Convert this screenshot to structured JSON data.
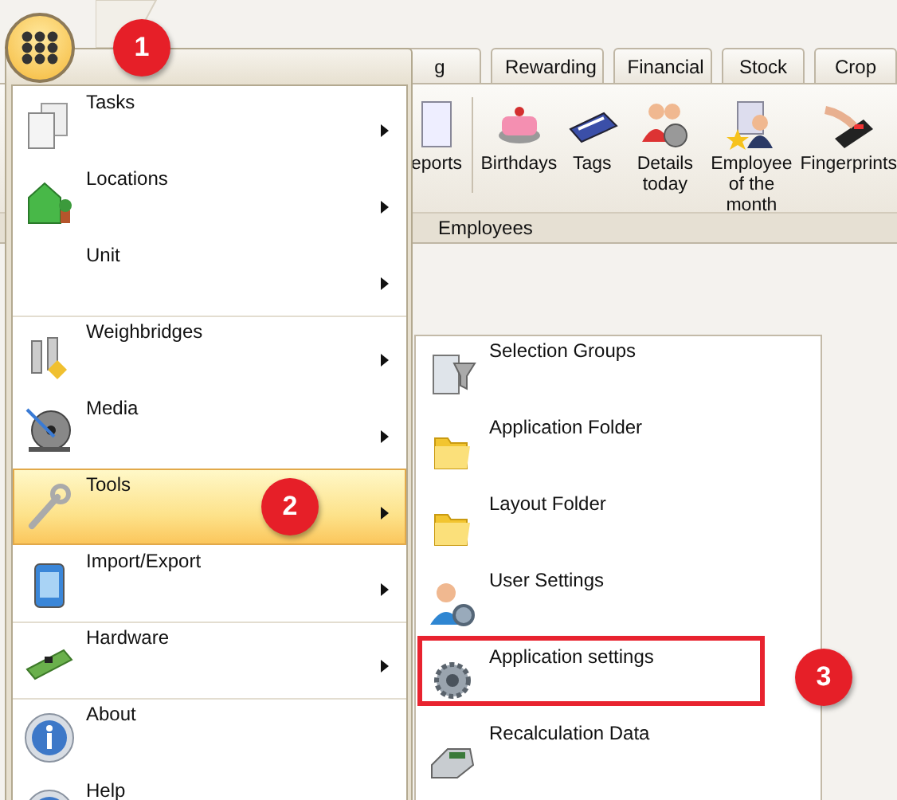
{
  "app_button": {
    "selected": true
  },
  "tabs": [
    {
      "label": "g",
      "selected": false
    },
    {
      "label": "Rewarding",
      "selected": false
    },
    {
      "label": "Financial",
      "selected": false
    },
    {
      "label": "Stock",
      "selected": false
    },
    {
      "label": "Crop",
      "selected": false
    }
  ],
  "ribbon": {
    "buttons": [
      {
        "label": "eports"
      },
      {
        "label": "Birthdays"
      },
      {
        "label": "Tags"
      },
      {
        "label": "Details today"
      },
      {
        "label": "Employee of the month"
      },
      {
        "label": "Fingerprints"
      }
    ],
    "group_label": "Employees"
  },
  "menu": {
    "items": [
      {
        "label": "Tasks",
        "submenu": true,
        "selected": false,
        "separator_before": false
      },
      {
        "label": "Locations",
        "submenu": true,
        "selected": false,
        "separator_before": false
      },
      {
        "label": "Unit",
        "submenu": true,
        "selected": false,
        "separator_before": false
      },
      {
        "label": "Weighbridges",
        "submenu": true,
        "selected": false,
        "separator_before": true
      },
      {
        "label": "Media",
        "submenu": true,
        "selected": false,
        "separator_before": false
      },
      {
        "label": "Tools",
        "submenu": true,
        "selected": true,
        "separator_before": false
      },
      {
        "label": "Import/Export",
        "submenu": true,
        "selected": false,
        "separator_before": false
      },
      {
        "label": "Hardware",
        "submenu": true,
        "selected": false,
        "separator_before": true
      },
      {
        "label": "About",
        "submenu": false,
        "selected": false,
        "separator_before": true
      },
      {
        "label": "Help",
        "submenu": false,
        "selected": false,
        "separator_before": false
      }
    ]
  },
  "submenu": {
    "items": [
      {
        "label": "Selection Groups",
        "outlined": false
      },
      {
        "label": "Application Folder",
        "outlined": false
      },
      {
        "label": "Layout Folder",
        "outlined": false
      },
      {
        "label": "User Settings",
        "outlined": false
      },
      {
        "label": "Application settings",
        "outlined": true
      },
      {
        "label": "Recalculation Data",
        "outlined": false
      }
    ]
  },
  "callouts": [
    {
      "number": "1"
    },
    {
      "number": "2"
    },
    {
      "number": "3"
    }
  ]
}
